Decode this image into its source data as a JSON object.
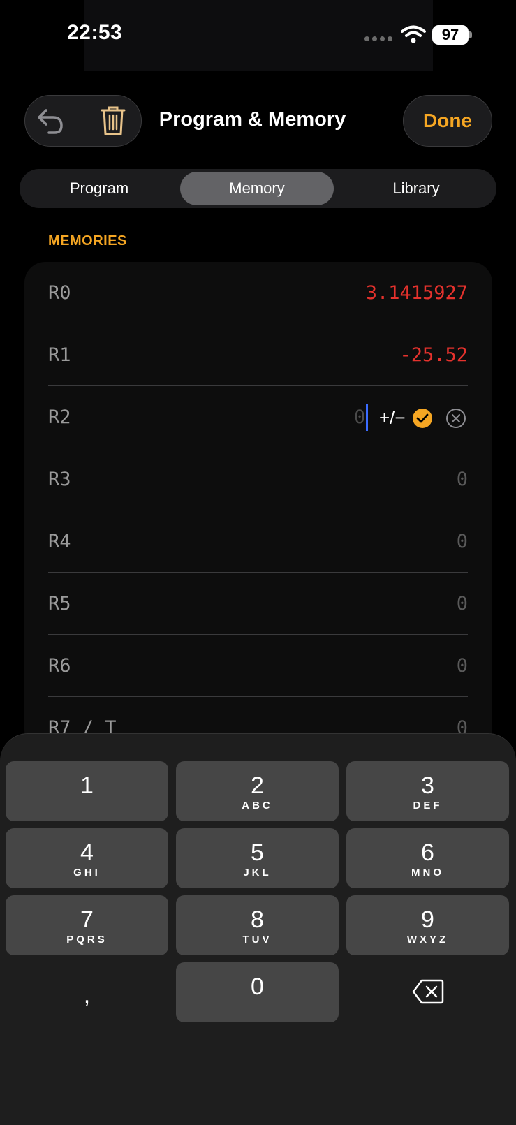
{
  "status_bar": {
    "time": "22:53",
    "battery": "97"
  },
  "header": {
    "title": "Program & Memory",
    "done_label": "Done",
    "undo_icon": "undo-icon",
    "trash_icon": "trash-icon"
  },
  "tabs": [
    {
      "label": "Program",
      "active": false
    },
    {
      "label": "Memory",
      "active": true
    },
    {
      "label": "Library",
      "active": false
    }
  ],
  "section": {
    "label": "MEMORIES"
  },
  "memories": [
    {
      "label": "R0",
      "value": "3.1415927"
    },
    {
      "label": "R1",
      "value": "-25.52"
    },
    {
      "label": "R2",
      "value": "0",
      "editing": true
    },
    {
      "label": "R3",
      "value": "0"
    },
    {
      "label": "R4",
      "value": "0"
    },
    {
      "label": "R5",
      "value": "0"
    },
    {
      "label": "R6",
      "value": "0"
    },
    {
      "label": "R7 / T",
      "value": "0"
    }
  ],
  "editor": {
    "plus_minus": "+/−",
    "accent": "#f5a623",
    "caret": "#3b6cff"
  },
  "keypad": [
    {
      "num": "1",
      "letters": ""
    },
    {
      "num": "2",
      "letters": "ABC"
    },
    {
      "num": "3",
      "letters": "DEF"
    },
    {
      "num": "4",
      "letters": "GHI"
    },
    {
      "num": "5",
      "letters": "JKL"
    },
    {
      "num": "6",
      "letters": "MNO"
    },
    {
      "num": "7",
      "letters": "PQRS"
    },
    {
      "num": "8",
      "letters": "TUV"
    },
    {
      "num": "9",
      "letters": "WXYZ"
    },
    {
      "num": ",",
      "letters": ""
    },
    {
      "num": "0",
      "letters": ""
    },
    {
      "num": "",
      "letters": "",
      "icon": "backspace-icon"
    }
  ]
}
